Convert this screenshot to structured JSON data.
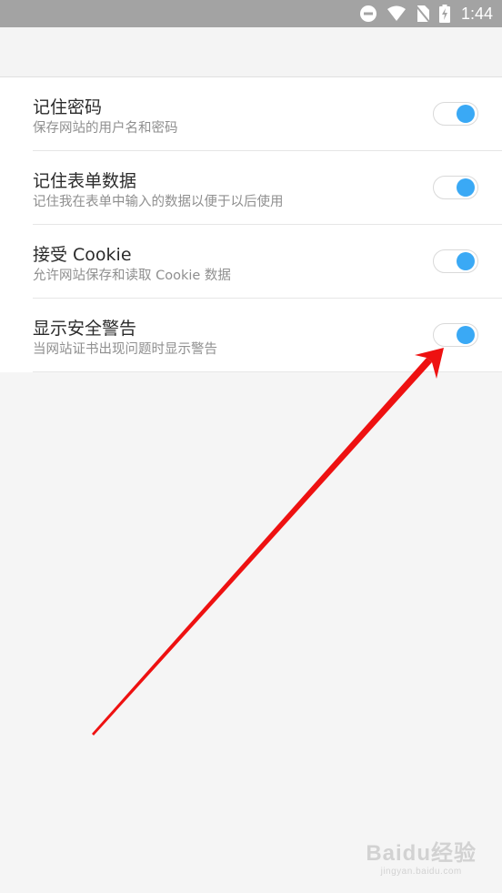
{
  "status_bar": {
    "time": "1:44",
    "icons": [
      "do-not-disturb-icon",
      "wifi-icon",
      "no-sim-icon",
      "battery-charging-icon"
    ]
  },
  "settings": [
    {
      "title": "记住密码",
      "subtitle": "保存网站的用户名和密码",
      "enabled": true
    },
    {
      "title": "记住表单数据",
      "subtitle": "记住我在表单中输入的数据以便于以后使用",
      "enabled": true
    },
    {
      "title": "接受 Cookie",
      "subtitle": "允许网站保存和读取 Cookie 数据",
      "enabled": true
    },
    {
      "title": "显示安全警告",
      "subtitle": "当网站证书出现问题时显示警告",
      "enabled": true
    }
  ],
  "colors": {
    "accent": "#3aa9f5",
    "annotation_arrow": "#ee1111",
    "status_bar": "#a3a3a3"
  },
  "watermark": {
    "brand": "Baidu经验",
    "url": "jingyan.baidu.com"
  }
}
